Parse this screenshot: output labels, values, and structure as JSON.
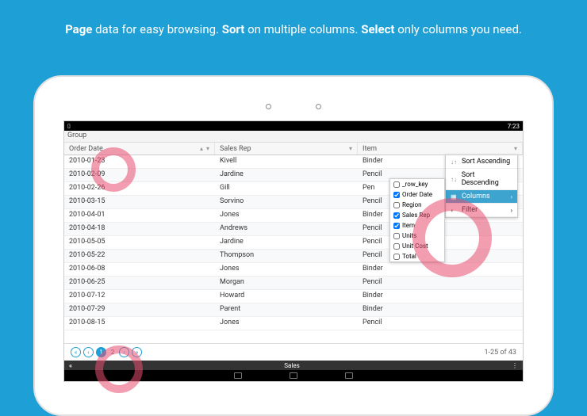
{
  "marketing": {
    "t1": "Page",
    "t2": " data for easy browsing. ",
    "t3": "Sort",
    "t4": " on multiple columns. ",
    "t5": "Select",
    "t6": " only columns you need."
  },
  "status": {
    "time": "7:23"
  },
  "group_label": "Group",
  "headers": {
    "date": "Order Date",
    "rep": "Sales Rep",
    "item": "Item"
  },
  "rows": [
    {
      "date": "2010-01-23",
      "rep": "Kivell",
      "item": "Binder"
    },
    {
      "date": "2010-02-09",
      "rep": "Jardine",
      "item": "Pencil"
    },
    {
      "date": "2010-02-26",
      "rep": "Gill",
      "item": "Pen"
    },
    {
      "date": "2010-03-15",
      "rep": "Sorvino",
      "item": "Pencil"
    },
    {
      "date": "2010-04-01",
      "rep": "Jones",
      "item": "Binder"
    },
    {
      "date": "2010-04-18",
      "rep": "Andrews",
      "item": "Pencil"
    },
    {
      "date": "2010-05-05",
      "rep": "Jardine",
      "item": "Pencil"
    },
    {
      "date": "2010-05-22",
      "rep": "Thompson",
      "item": "Pencil"
    },
    {
      "date": "2010-06-08",
      "rep": "Jones",
      "item": "Binder"
    },
    {
      "date": "2010-06-25",
      "rep": "Morgan",
      "item": "Pencil"
    },
    {
      "date": "2010-07-12",
      "rep": "Howard",
      "item": "Binder"
    },
    {
      "date": "2010-07-29",
      "rep": "Parent",
      "item": "Binder"
    },
    {
      "date": "2010-08-15",
      "rep": "Jones",
      "item": "Pencil"
    }
  ],
  "pager": {
    "first": "«",
    "prev": "‹",
    "p1": "1",
    "p2": "2",
    "next": "›",
    "last": "»",
    "info": "1-25 of 43"
  },
  "bottom": {
    "back": "«",
    "title": "Sales",
    "more": "⋮"
  },
  "menu": {
    "sort_asc": "Sort Ascending",
    "sort_desc": "Sort Descending",
    "columns": "Columns",
    "filter": "Filter"
  },
  "column_choices": [
    {
      "label": "_row_key",
      "checked": false
    },
    {
      "label": "Order Date",
      "checked": true
    },
    {
      "label": "Region",
      "checked": false
    },
    {
      "label": "Sales Rep",
      "checked": true
    },
    {
      "label": "Item",
      "checked": true
    },
    {
      "label": "Units",
      "checked": false
    },
    {
      "label": "Unit Cost",
      "checked": false
    },
    {
      "label": "Total",
      "checked": false
    }
  ]
}
